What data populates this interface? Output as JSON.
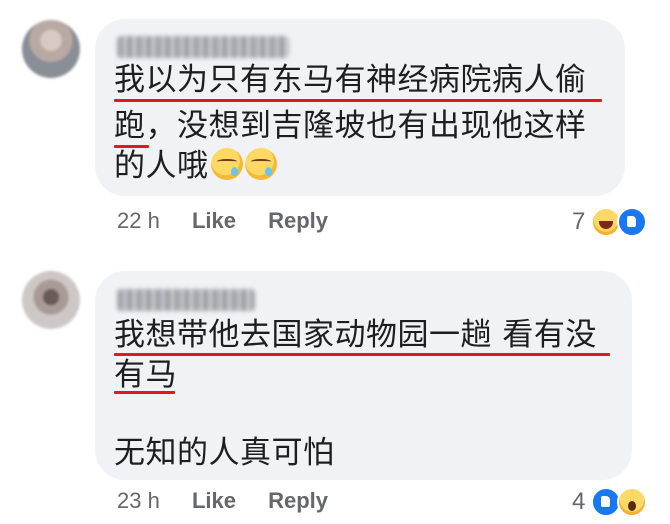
{
  "comments": [
    {
      "lines": [
        "我以为只有东马有神经病院病人偷",
        "跑，没想到吉隆坡也有出现他这样",
        "的人哦"
      ],
      "emoji_icons": [
        "sad-relieved-face-icon",
        "sad-relieved-face-icon"
      ],
      "time": "22 h",
      "like_label": "Like",
      "reply_label": "Reply",
      "reaction_count": "7",
      "reaction_icons": [
        "haha-reaction-icon",
        "like-reaction-icon"
      ]
    },
    {
      "lines": [
        "我想带他去国家动物园一趟 看有没",
        "有马",
        "无知的人真可怕"
      ],
      "time": "23 h",
      "like_label": "Like",
      "reply_label": "Reply",
      "reaction_count": "4",
      "reaction_icons": [
        "like-reaction-icon",
        "wow-reaction-icon"
      ]
    }
  ],
  "colors": {
    "bubble": "#f0f2f5",
    "text": "#1c1e21",
    "meta": "#65676b",
    "highlight_underline": "#e3181e",
    "like_blue": "#1877f2"
  }
}
